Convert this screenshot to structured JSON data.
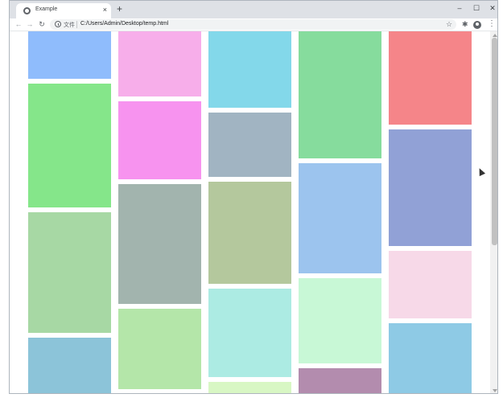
{
  "browser": {
    "tab_title": "Example",
    "tab_close": "×",
    "new_tab": "+",
    "window_controls": {
      "minimize": "–",
      "maximize": "☐",
      "close": "✕"
    },
    "nav": {
      "back": "←",
      "forward": "→",
      "reload": "↻"
    },
    "omnibox": {
      "file_label": "文件",
      "url": "C:/Users/Admin/Desktop/temp.html"
    },
    "icons": {
      "tab_favicon": "globe-icon",
      "info": "info-icon",
      "star": "star-icon",
      "star_glyph": "☆",
      "extensions": "puzzle-icon",
      "extensions_glyph": "✱",
      "profile": "profile-icon",
      "menu": "menu-icon",
      "menu_glyph": "⋮"
    }
  },
  "masonry": {
    "columns": [
      {
        "tiles": [
          {
            "color": "#8fbcfc"
          },
          {
            "color": "#85e68a"
          },
          {
            "color": "#a7d8a4"
          },
          {
            "color": "#8cc4d9"
          }
        ]
      },
      {
        "tiles": [
          {
            "color": "#f7aeea"
          },
          {
            "color": "#f793ef"
          },
          {
            "color": "#a2b4ae"
          },
          {
            "color": "#b4e6a9"
          }
        ]
      },
      {
        "tiles": [
          {
            "color": "#83d8ea"
          },
          {
            "color": "#a1b4c2"
          },
          {
            "color": "#b4c89d"
          },
          {
            "color": "#acebe3"
          },
          {
            "color": "#d8f7c4"
          }
        ]
      },
      {
        "tiles": [
          {
            "color": "#86dc9d"
          },
          {
            "color": "#9cc4ee"
          },
          {
            "color": "#c8f8d6"
          },
          {
            "color": "#b38cae"
          }
        ]
      },
      {
        "tiles": [
          {
            "color": "#f58589"
          },
          {
            "color": "#91a1d6"
          },
          {
            "color": "#f7d9e8"
          },
          {
            "color": "#8ecae5"
          }
        ]
      }
    ]
  }
}
